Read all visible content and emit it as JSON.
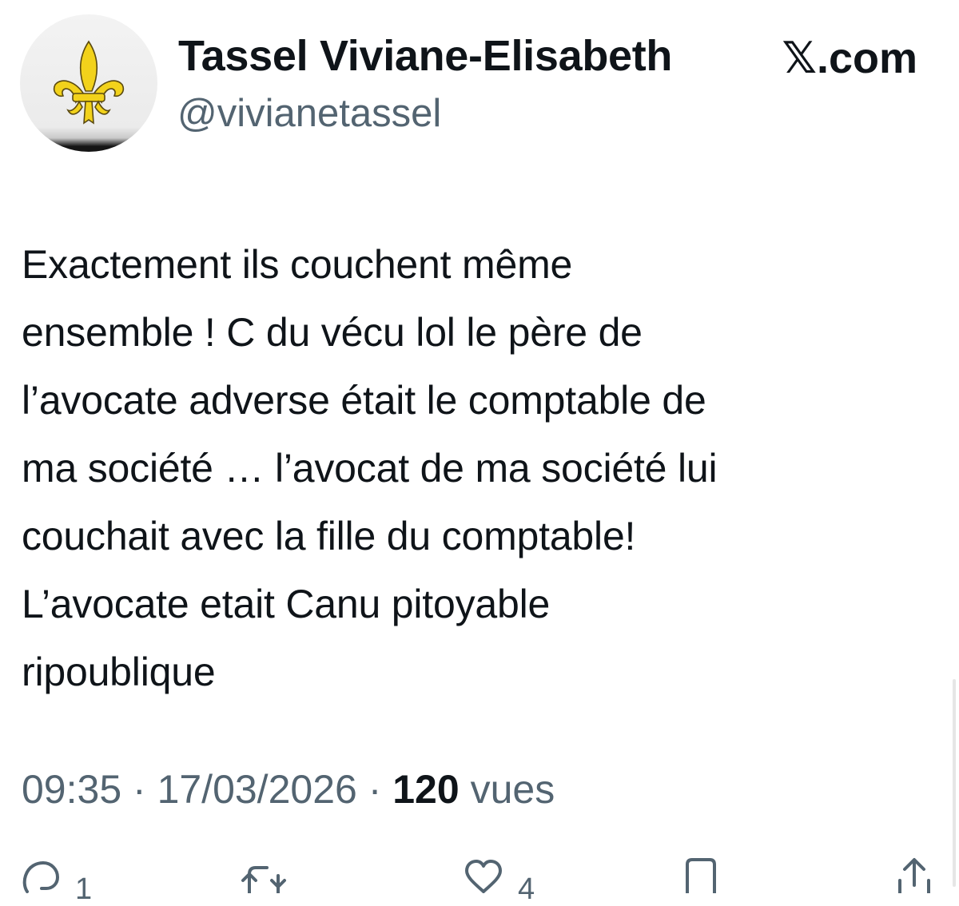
{
  "author": {
    "display_name": "Tassel Viviane-Elisabeth",
    "handle": "@vivianetassel",
    "avatar_icon": "fleur-de-lis-icon"
  },
  "source_label": "𝕏.com",
  "tweet": {
    "text": "Exactement ils couchent même\nensemble ! C du vécu lol le père de\nl’avocate adverse était le comptable de\nma société … l’avocat de ma société lui\ncouchait avec  la fille du comptable!\nL’avocate etait  Canu pitoyable\nripoublique"
  },
  "meta": {
    "time": "09:35",
    "separator": " · ",
    "date": "17/03/2026",
    "views_count": "120",
    "views_label": "vues"
  },
  "actions": {
    "reply_count": "1",
    "like_count": "4"
  },
  "colors": {
    "text": "#0f1419",
    "secondary": "#536471",
    "fleur": "#f2d21b"
  }
}
